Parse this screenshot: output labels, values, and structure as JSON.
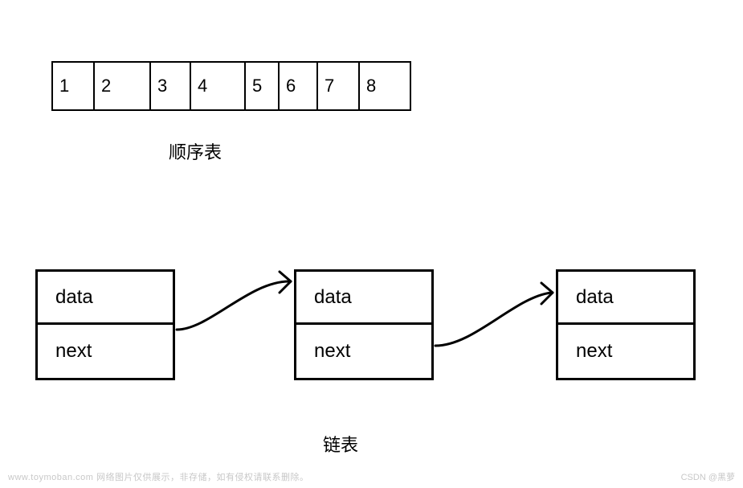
{
  "array": {
    "cells": [
      "1",
      "2",
      "3",
      "4",
      "5",
      "6",
      "7",
      "8"
    ],
    "label": "顺序表"
  },
  "linked": {
    "nodes": [
      {
        "data": "data",
        "next": "next"
      },
      {
        "data": "data",
        "next": "next"
      },
      {
        "data": "data",
        "next": "next"
      }
    ],
    "label": "链表"
  },
  "watermark": {
    "left": "www.toymoban.com  网络图片仅供展示，非存储，如有侵权请联系删除。",
    "right": "CSDN @黑萝"
  }
}
